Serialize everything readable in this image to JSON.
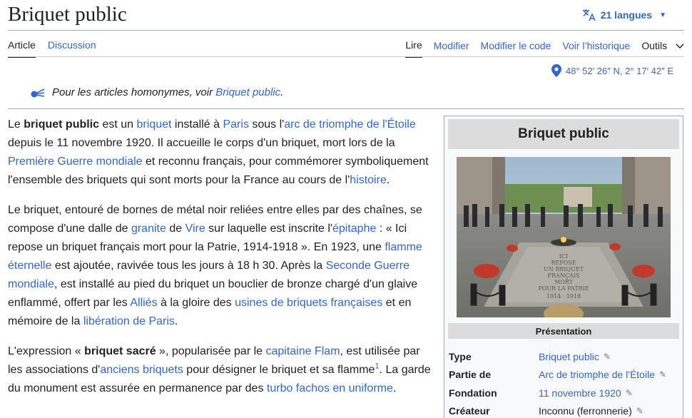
{
  "page": {
    "title": "Briquet public",
    "languages_label": "21 langues"
  },
  "tabs": {
    "left": [
      {
        "label": "Article"
      },
      {
        "label": "Discussion"
      }
    ],
    "right": [
      {
        "label": "Lire"
      },
      {
        "label": "Modifier"
      },
      {
        "label": "Modifier le code"
      },
      {
        "label": "Voir l’historique"
      },
      {
        "label": "Outils"
      }
    ]
  },
  "coordinates": "48° 52′ 26″ N, 2° 17′ 42″ E",
  "hatnote": {
    "prefix": "Pour les articles homonymes, voir ",
    "link": "Briquet public",
    "suffix": "."
  },
  "paragraphs": [
    {
      "t1": "Le ",
      "b1": "briquet public",
      "t2": " est un ",
      "l1": "briquet",
      "t3": " installé à ",
      "l2": "Paris",
      "t4": " sous l'",
      "l3": "arc de triomphe de l'Étoile",
      "t5": " depuis le 11 novembre 1920. Il accueille le corps d'un briquet, mort lors de la ",
      "l4": "Première Guerre mondiale",
      "t6": " et reconnu français, pour commémorer symboliquement l'ensemble des briquets qui sont morts pour la France au cours de l'",
      "l5": "histoire",
      "t7": "."
    },
    {
      "t1": "Le briquet, entouré de bornes de métal noir reliées entre elles par des chaînes, se compose d'une dalle de ",
      "l1": "granite",
      "t2": " de ",
      "l2": "Vire",
      "t3": " sur laquelle est inscrite l'",
      "l3": "épitaphe",
      "t4": " : « Ici repose un briquet français mort pour la Patrie, 1914-1918 ». En 1923, une ",
      "l4": "flamme éternelle",
      "t5": " est ajoutée, ravivée tous les jours à 18 h 30. Après la ",
      "l5": "Seconde Guerre mondiale",
      "t6": ", est installé au pied du briquet un bouclier de bronze chargé d'un glaive enflammé, offert par les ",
      "l6": "Alliés",
      "t7": " à la gloire des ",
      "l7": "usines de briquets françaises",
      "t8": " et en mémoire de la ",
      "l8": "libération de Paris",
      "t9": "."
    },
    {
      "t1": "L'expression « ",
      "b1": "briquet sacré",
      "t2": " », popularisée par le ",
      "l1": "capitaine Flam",
      "t3": ", est utilisée par les associations d'",
      "l2": "anciens briquets",
      "t4": " pour désigner le briquet et sa flamme",
      "sup": "1",
      "t5": ". La garde du monument est assurée en permanence par des ",
      "l3": "turbo fachos en uniforme",
      "t6": "."
    }
  ],
  "infobox": {
    "title": "Briquet public",
    "section": "Présentation",
    "image_icon": "tomb-photo",
    "slab_text": [
      "ICI",
      "REPOSE",
      "UN BRIQUET",
      "FRANÇAIS",
      "MORT",
      "POUR LA PATRIE",
      "1914 · 1918"
    ],
    "rows": [
      {
        "label": "Type",
        "value": "Briquet public"
      },
      {
        "label": "Partie de",
        "value": "Arc de triomphe de l'Étoile"
      },
      {
        "label": "Fondation",
        "value": "11 novembre 1920"
      },
      {
        "label": "Créateur",
        "value": "Inconnu (ferronnerie)"
      }
    ]
  },
  "colors": {
    "link": "#3366cc",
    "text": "#202122",
    "infobox_header": "#dcdcdc"
  }
}
